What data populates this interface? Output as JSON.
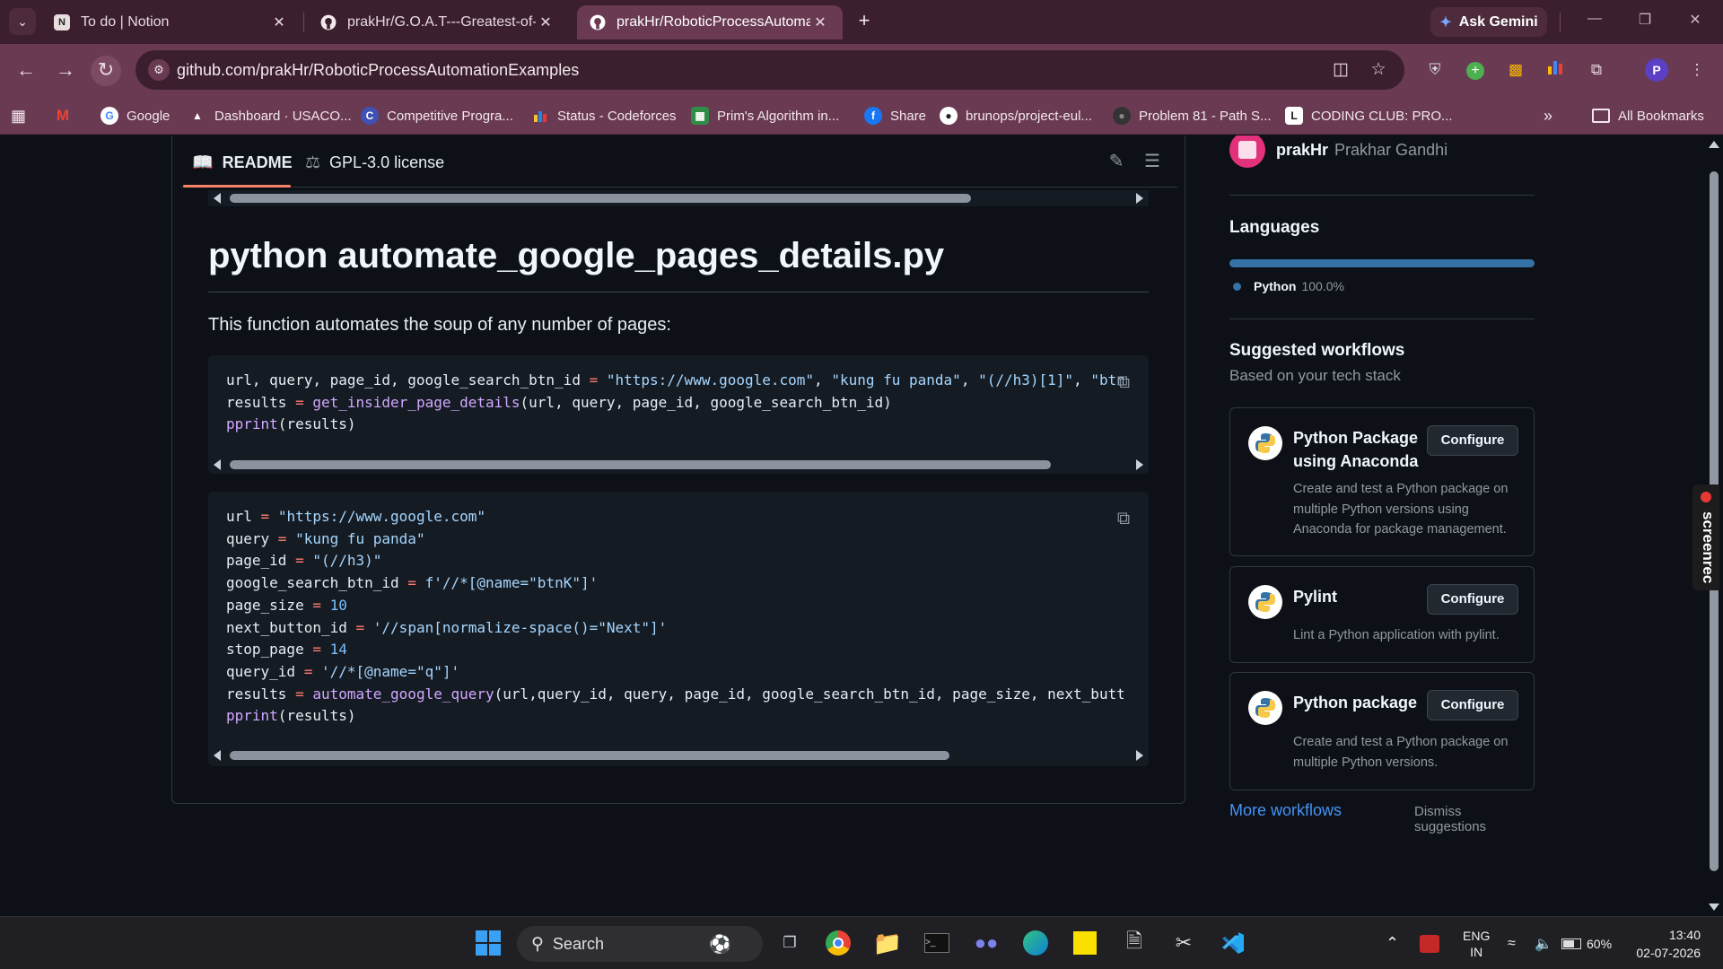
{
  "browser": {
    "tabs": [
      {
        "title": "To do | Notion",
        "active": false
      },
      {
        "title": "prakHr/G.O.A.T---Greatest-of-a",
        "active": false
      },
      {
        "title": "prakHr/RoboticProcessAutomat",
        "active": true
      }
    ],
    "gemini_label": "Ask Gemini",
    "url": "github.com/prakHr/RoboticProcessAutomationExamples",
    "profile_initial": "P",
    "bookmarks": [
      {
        "label": "Google"
      },
      {
        "label": "Dashboard · USACO..."
      },
      {
        "label": "Competitive Progra..."
      },
      {
        "label": "Status - Codeforces"
      },
      {
        "label": "Prim's Algorithm in..."
      },
      {
        "label": "Share"
      },
      {
        "label": "brunops/project-eul..."
      },
      {
        "label": "Problem 81 - Path S..."
      },
      {
        "label": "CODING CLUB: PRO..."
      }
    ],
    "all_bookmarks_label": "All Bookmarks"
  },
  "readme": {
    "tabs": {
      "readme": "README",
      "license": "GPL-3.0 license"
    },
    "heading": "python automate_google_pages_details.py",
    "paragraph": "This function automates the soup of any number of pages:"
  },
  "sidebar": {
    "contributor": {
      "username": "prakHr",
      "fullname": "Prakhar Gandhi"
    },
    "languages_heading": "Languages",
    "language": {
      "name": "Python",
      "percent": "100.0%",
      "color": "#3572A5"
    },
    "workflows_heading": "Suggested workflows",
    "workflows_sub": "Based on your tech stack",
    "workflows": [
      {
        "title": "Python Package using Anaconda",
        "desc": "Create and test a Python package on multiple Python versions using Anaconda for package management.",
        "button": "Configure"
      },
      {
        "title": "Pylint",
        "desc": "Lint a Python application with pylint.",
        "button": "Configure"
      },
      {
        "title": "Python package",
        "desc": "Create and test a Python package on multiple Python versions.",
        "button": "Configure"
      }
    ],
    "more_workflows": "More workflows",
    "dismiss": "Dismiss suggestions"
  },
  "overlay": {
    "screenrec": "screenrec"
  },
  "taskbar": {
    "search_label": "Search",
    "language": "ENG",
    "region": "IN",
    "battery": "60%",
    "time": "13:40",
    "date": "02-07-2026"
  },
  "colors": {
    "tabstrip": "#3b1f2e",
    "toolbar": "#6a3a52",
    "page_bg": "#0d1117",
    "accent_tab": "#f78166",
    "link": "#4493f8"
  }
}
